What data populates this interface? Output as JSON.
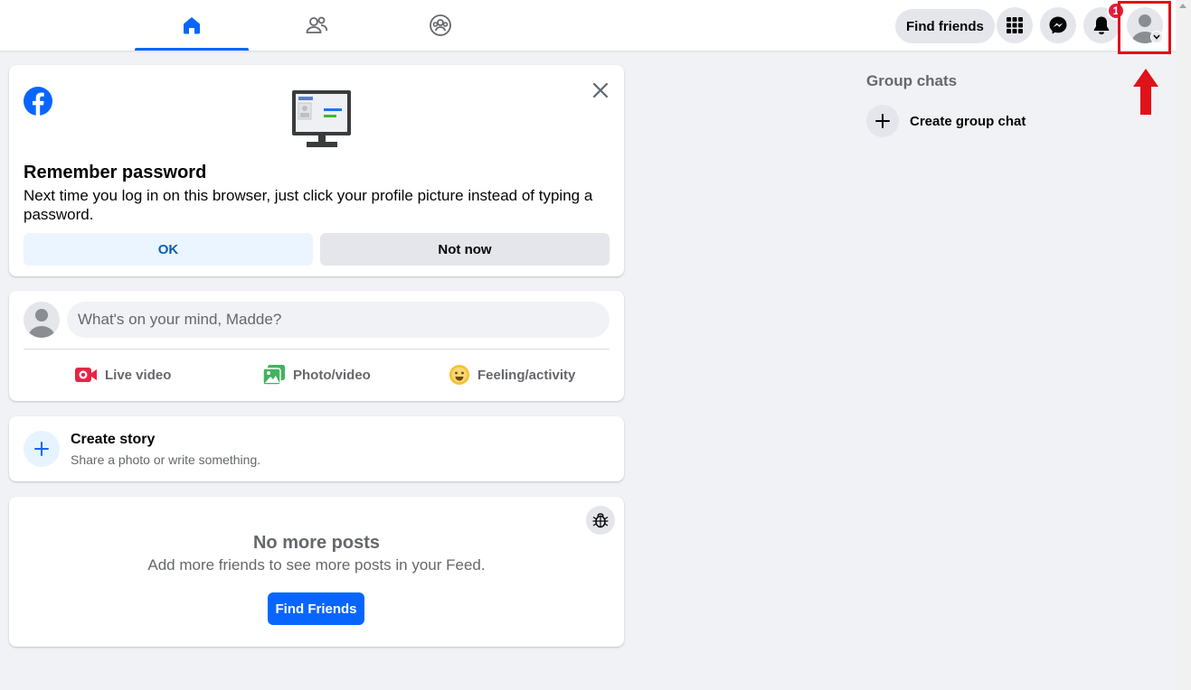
{
  "nav": {
    "tabs": [
      {
        "icon": "home-icon",
        "active": true
      },
      {
        "icon": "friends-icon",
        "active": false
      },
      {
        "icon": "groups-icon",
        "active": false
      }
    ],
    "find_friends_label": "Find friends",
    "icons": [
      "menu-grid-icon",
      "messenger-icon",
      "notifications-icon",
      "account-avatar"
    ],
    "notification_count": "1"
  },
  "remember_password": {
    "title": "Remember password",
    "description": "Next time you log in on this browser, just click your profile picture instead of typing a password.",
    "ok_label": "OK",
    "not_now_label": "Not now"
  },
  "composer": {
    "placeholder": "What's on your mind, Madde?",
    "actions": {
      "live_video": "Live video",
      "photo_video": "Photo/video",
      "feeling_activity": "Feeling/activity"
    }
  },
  "create_story": {
    "title": "Create story",
    "subtitle": "Share a photo or write something."
  },
  "no_more_posts": {
    "title": "No more posts",
    "description": "Add more friends to see more posts in your Feed.",
    "button_label": "Find Friends"
  },
  "group_chats": {
    "title": "Group chats",
    "create_label": "Create group chat"
  },
  "colors": {
    "brand_blue": "#0866ff",
    "badge_red": "#e41e3f",
    "highlight_red": "#e0121a"
  }
}
